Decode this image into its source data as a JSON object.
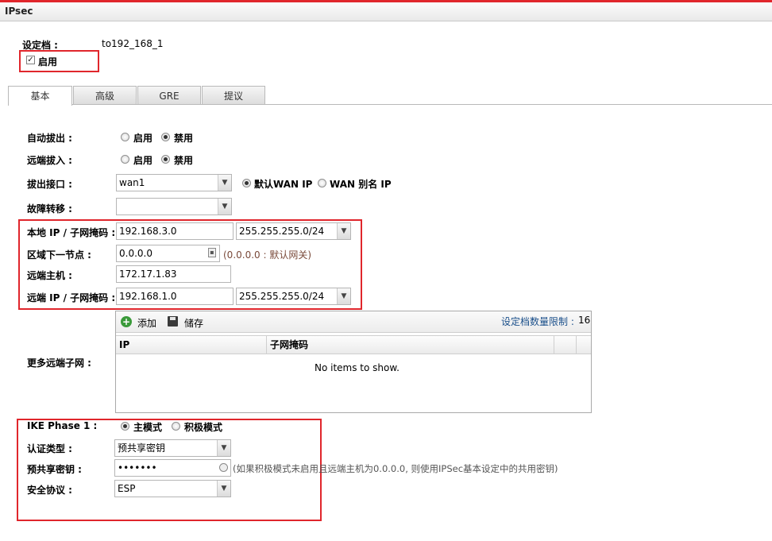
{
  "window": {
    "title": "IPsec"
  },
  "profile": {
    "label": "设定档 :",
    "value": "to192_168_1",
    "enable_label": "启用",
    "enabled": true
  },
  "tabs": [
    {
      "label": "基本",
      "active": true
    },
    {
      "label": "高级"
    },
    {
      "label": "GRE"
    },
    {
      "label": "提议"
    }
  ],
  "basic": {
    "auto_dial": {
      "label": "自动拔出 :",
      "options": [
        "启用",
        "禁用"
      ],
      "selected": "禁用"
    },
    "remote_dial": {
      "label": "远端拔入 :",
      "options": [
        "启用",
        "禁用"
      ],
      "selected": "禁用"
    },
    "dial_interface": {
      "label": "拔出接口 :",
      "value": "wan1",
      "ip_options": [
        "默认WAN IP",
        "WAN 别名 IP"
      ],
      "ip_selected": "默认WAN IP"
    },
    "failover": {
      "label": "故障转移 :",
      "value": ""
    },
    "local_ip": {
      "label": "本地 IP / 子网掩码 :",
      "ip": "192.168.3.0",
      "mask": "255.255.255.0/24"
    },
    "next_hop": {
      "label": "区域下一节点 :",
      "value": "0.0.0.0",
      "hint": "(0.0.0.0 : 默认网关)"
    },
    "remote_host": {
      "label": "远端主机 :",
      "value": "172.17.1.83"
    },
    "remote_ip": {
      "label": "远端 IP / 子网掩码 :",
      "ip": "192.168.1.0",
      "mask": "255.255.255.0/24"
    }
  },
  "more_subnets": {
    "label": "更多远端子网 :",
    "toolbar": {
      "add": "添加",
      "save": "储存",
      "limit_label": "设定档数量限制 :",
      "limit_value": "16"
    },
    "columns": [
      "IP",
      "子网掩码"
    ],
    "empty_text": "No items to show."
  },
  "ike": {
    "phase_label": "IKE Phase 1 :",
    "mode_options": [
      "主模式",
      "积极模式"
    ],
    "mode_selected": "主模式",
    "auth_type": {
      "label": "认证类型 :",
      "value": "预共享密钥"
    },
    "psk": {
      "label": "预共享密钥 :",
      "value": "•••••••",
      "hint": "(如果积极模式未启用且远端主机为0.0.0.0, 则使用IPSec基本设定中的共用密钥)"
    },
    "protocol": {
      "label": "安全协议 :",
      "value": "ESP"
    }
  },
  "colors": {
    "highlight_box": "#e0262c",
    "top_bar": "#e0262c"
  }
}
